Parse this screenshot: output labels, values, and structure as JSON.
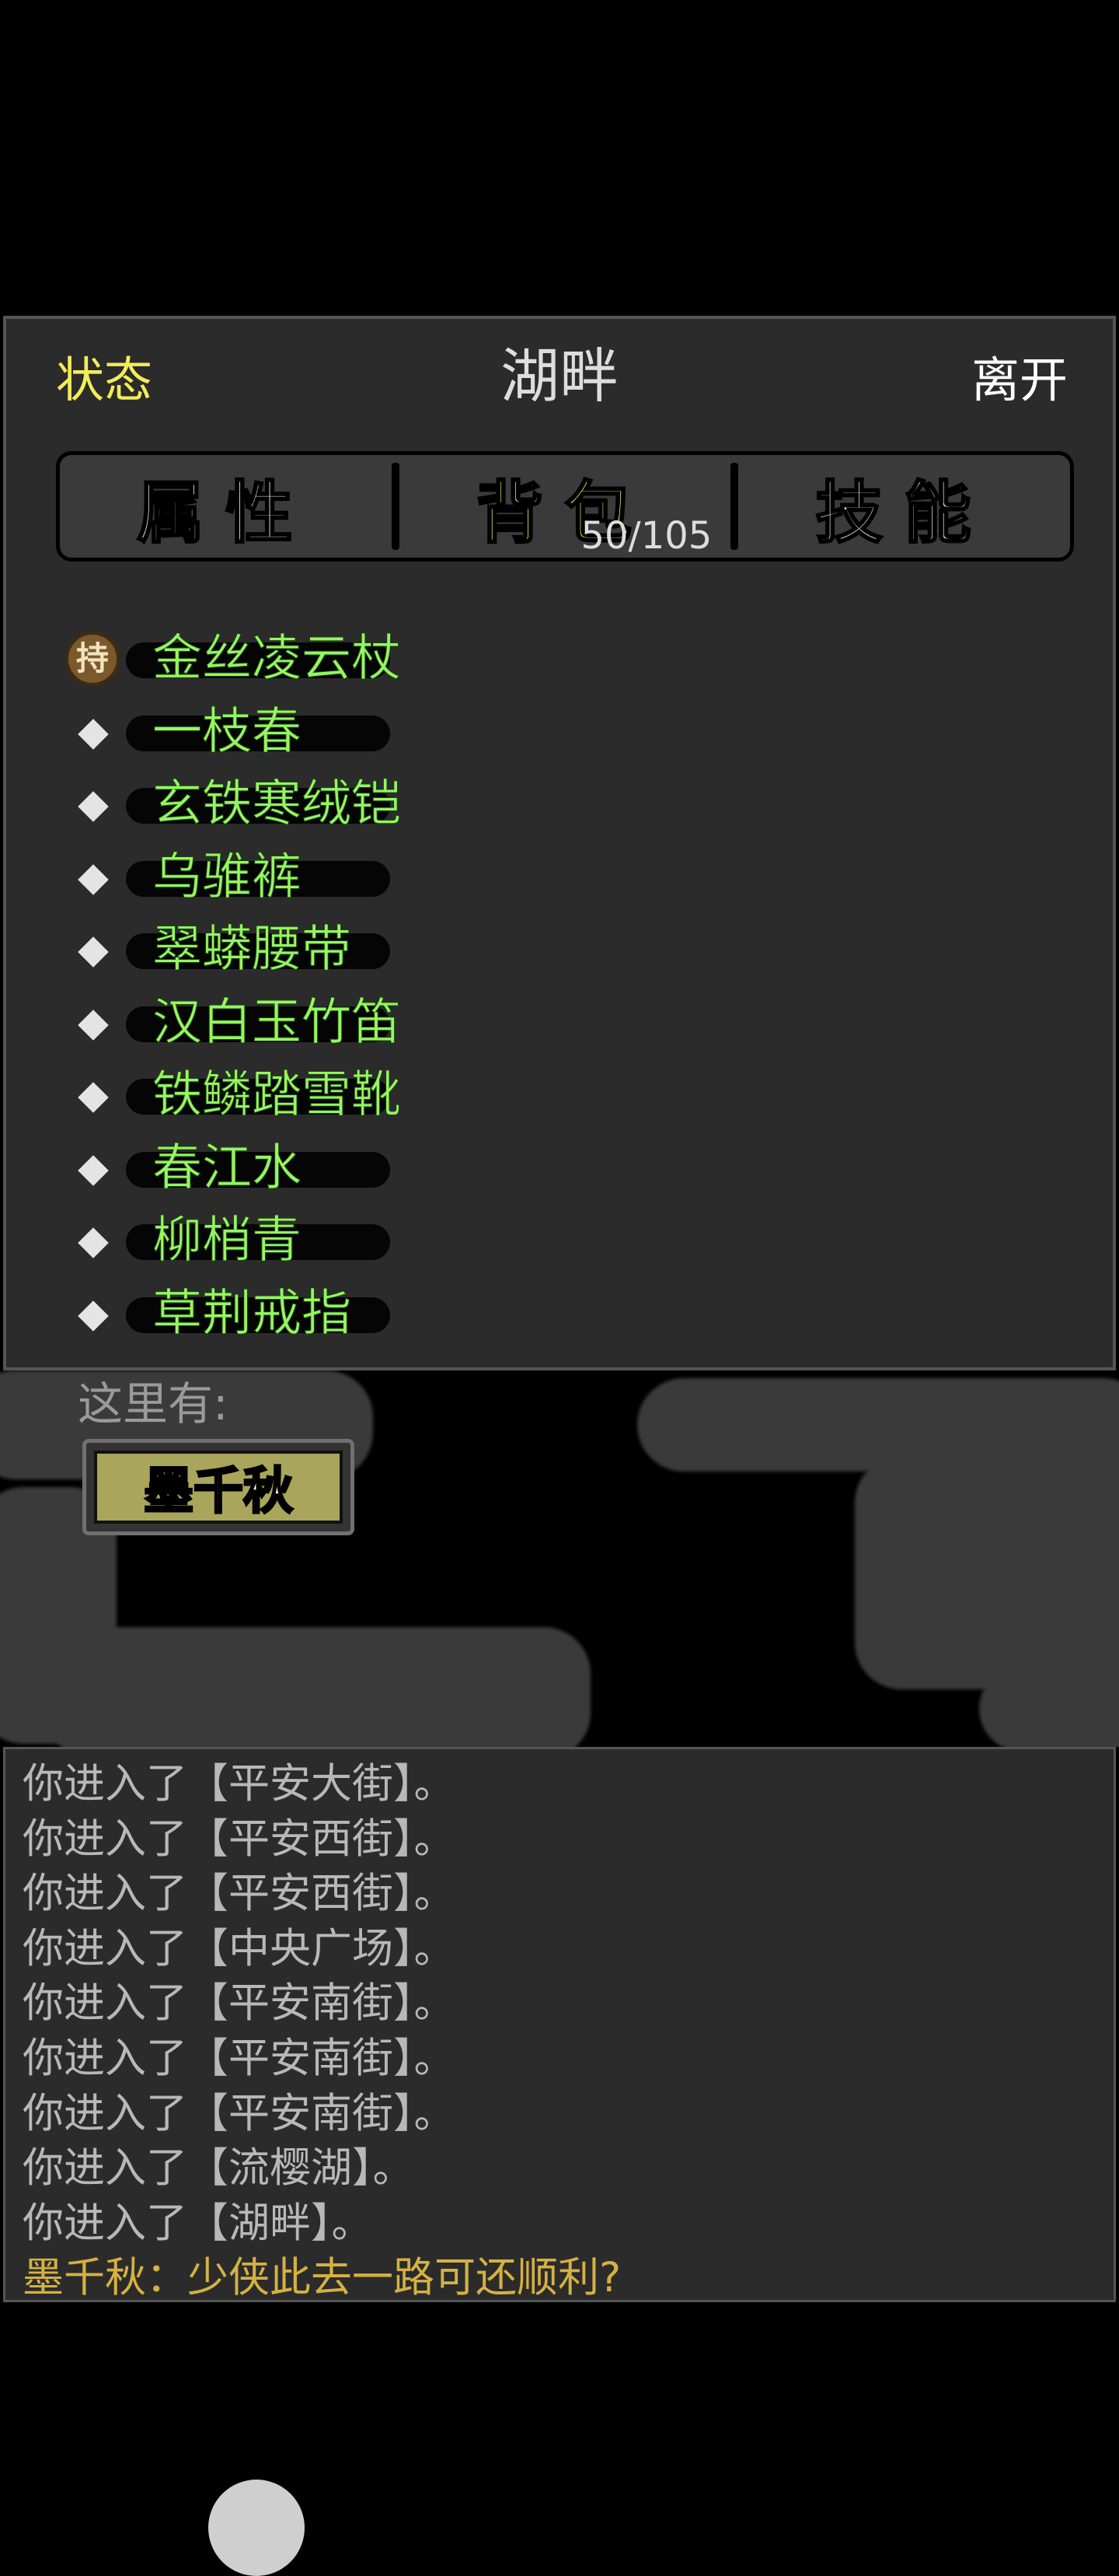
{
  "header": {
    "status_label": "状态",
    "location": "湖畔",
    "leave_label": "离开"
  },
  "tabs": [
    {
      "label": "属性",
      "active": false
    },
    {
      "label": "背包",
      "active": true,
      "count": "50/105"
    },
    {
      "label": "技能",
      "active": false
    }
  ],
  "inventory": {
    "equipped_badge": "持",
    "items": [
      {
        "name": "金丝凌云杖",
        "equipped": true
      },
      {
        "name": "一枝春",
        "equipped": false
      },
      {
        "name": "玄铁寒绒铠",
        "equipped": false
      },
      {
        "name": "乌骓裤",
        "equipped": false
      },
      {
        "name": "翠蟒腰带",
        "equipped": false
      },
      {
        "name": "汉白玉竹笛",
        "equipped": false
      },
      {
        "name": "铁鳞踏雪靴",
        "equipped": false
      },
      {
        "name": "春江水",
        "equipped": false
      },
      {
        "name": "柳梢青",
        "equipped": false
      },
      {
        "name": "草荆戒指",
        "equipped": false
      }
    ]
  },
  "scene": {
    "here_label": "这里有:",
    "npcs": [
      "墨千秋"
    ]
  },
  "log": {
    "lines": [
      "你进入了【平安大街】。",
      "你进入了【平安西街】。",
      "你进入了【平安西街】。",
      "你进入了【中央广场】。",
      "你进入了【平安南街】。",
      "你进入了【平安南街】。",
      "你进入了【平安南街】。",
      "你进入了【流樱湖】。",
      "你进入了【湖畔】。"
    ],
    "dialog": "墨千秋：少侠此去一路可还顺利?"
  },
  "colors": {
    "status": "#f2ec5a",
    "active_tab": "#f5e94a",
    "item_name": "#97f562",
    "dialog": "#d4b142",
    "panel_bg": "#2b2b2b"
  }
}
